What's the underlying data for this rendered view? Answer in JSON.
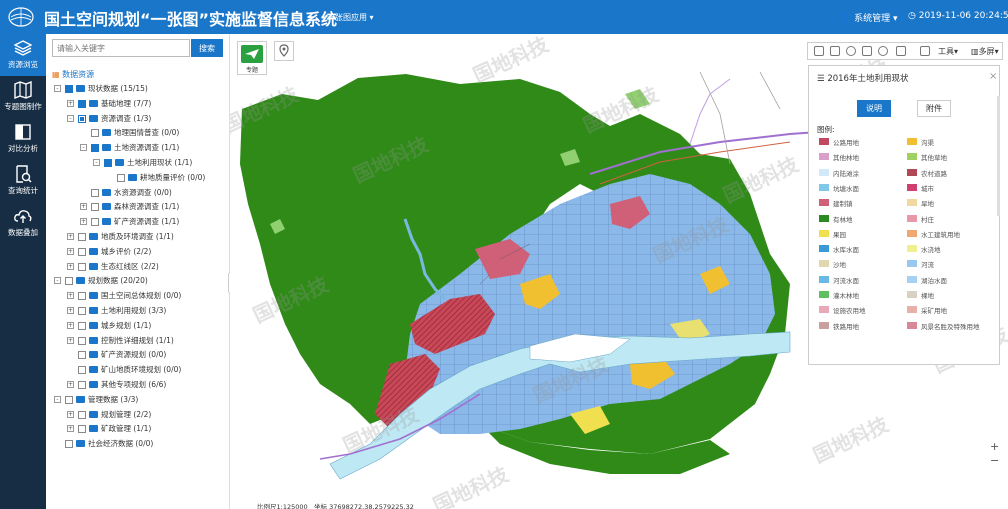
{
  "header": {
    "title": "国土空间规划“一张图”实施监督信息系统",
    "module": "一张图应用",
    "user": "系统管理",
    "datetime": "2019-11-06 20:24:51"
  },
  "nav": [
    {
      "label": "资源浏览",
      "active": true,
      "icon": "layers-icon"
    },
    {
      "label": "专题图制作",
      "icon": "map-icon"
    },
    {
      "label": "对比分析",
      "icon": "compare-icon"
    },
    {
      "label": "查询统计",
      "icon": "query-icon"
    },
    {
      "label": "数据叠加",
      "icon": "upload-cloud-icon"
    }
  ],
  "search": {
    "placeholder": "请输入关键字",
    "button": "搜索"
  },
  "tree_root": "数据资源",
  "tree": [
    {
      "label": "现状数据 (15/15)",
      "level": 0,
      "exp": "-",
      "chk": "on"
    },
    {
      "label": "基础地理 (7/7)",
      "level": 1,
      "exp": "+",
      "chk": "on"
    },
    {
      "label": "资源调查 (1/3)",
      "level": 1,
      "exp": "-",
      "chk": "half"
    },
    {
      "label": "地理国情普查 (0/0)",
      "level": 2,
      "exp": "",
      "chk": ""
    },
    {
      "label": "土地资源调查 (1/1)",
      "level": 2,
      "exp": "-",
      "chk": "on"
    },
    {
      "label": "土地利用现状 (1/1)",
      "level": 3,
      "exp": "-",
      "chk": "on"
    },
    {
      "label": "耕地质量评价 (0/0)",
      "level": 4,
      "exp": "",
      "chk": ""
    },
    {
      "label": "水资源调查 (0/0)",
      "level": 2,
      "exp": "",
      "chk": ""
    },
    {
      "label": "森林资源调查 (1/1)",
      "level": 2,
      "exp": "+",
      "chk": ""
    },
    {
      "label": "矿产资源调查 (1/1)",
      "level": 2,
      "exp": "+",
      "chk": ""
    },
    {
      "label": "地质及环境调查 (1/1)",
      "level": 1,
      "exp": "+",
      "chk": ""
    },
    {
      "label": "城乡评价 (2/2)",
      "level": 1,
      "exp": "+",
      "chk": ""
    },
    {
      "label": "生态红线区 (2/2)",
      "level": 1,
      "exp": "+",
      "chk": ""
    },
    {
      "label": "规划数据 (20/20)",
      "level": 0,
      "exp": "-",
      "chk": ""
    },
    {
      "label": "国土空间总体规划 (0/0)",
      "level": 1,
      "exp": "+",
      "chk": ""
    },
    {
      "label": "土地利用规划 (3/3)",
      "level": 1,
      "exp": "+",
      "chk": ""
    },
    {
      "label": "城乡规划 (1/1)",
      "level": 1,
      "exp": "+",
      "chk": ""
    },
    {
      "label": "控制性详细规划 (1/1)",
      "level": 1,
      "exp": "+",
      "chk": ""
    },
    {
      "label": "矿产资源规划 (0/0)",
      "level": 1,
      "exp": "",
      "chk": ""
    },
    {
      "label": "矿山地质环境规划 (0/0)",
      "level": 1,
      "exp": "",
      "chk": ""
    },
    {
      "label": "其他专项规划 (6/6)",
      "level": 1,
      "exp": "+",
      "chk": ""
    },
    {
      "label": "管理数据 (3/3)",
      "level": 0,
      "exp": "-",
      "chk": ""
    },
    {
      "label": "规划管理 (2/2)",
      "level": 1,
      "exp": "+",
      "chk": ""
    },
    {
      "label": "矿政管理 (1/1)",
      "level": 1,
      "exp": "+",
      "chk": ""
    },
    {
      "label": "社会经济数据 (0/0)",
      "level": 0,
      "exp": "",
      "chk": ""
    }
  ],
  "map": {
    "topic_button": "专题",
    "scale": "比例尺1:125000",
    "coords": "坐标 37698272.38,2579225.32",
    "toolbar": {
      "tools": "工具",
      "multiscreen": "多屏"
    }
  },
  "legend": {
    "title": "2016年土地利用现状",
    "tab_desc": "说明",
    "tab_attach": "附件",
    "label": "图例:",
    "items": [
      {
        "name": "公路用地",
        "color": "#c04860"
      },
      {
        "name": "沟渠",
        "color": "#f0c030"
      },
      {
        "name": "其他林地",
        "color": "#d8a0c8"
      },
      {
        "name": "其他草地",
        "color": "#a0d060"
      },
      {
        "name": "内陆滩涂",
        "color": "#d0e8f8"
      },
      {
        "name": "农村道路",
        "color": "#b04858"
      },
      {
        "name": "坑塘水面",
        "color": "#80c8e8"
      },
      {
        "name": "城市",
        "color": "#d04070"
      },
      {
        "name": "建制镇",
        "color": "#d06078"
      },
      {
        "name": "旱地",
        "color": "#f0d8a0"
      },
      {
        "name": "有林地",
        "color": "#2a8a20"
      },
      {
        "name": "村庄",
        "color": "#e898a8"
      },
      {
        "name": "果园",
        "color": "#f0e050"
      },
      {
        "name": "水工建筑用地",
        "color": "#f0a870"
      },
      {
        "name": "水库水面",
        "color": "#3a9ad8"
      },
      {
        "name": "水浇地",
        "color": "#f0f090"
      },
      {
        "name": "沙地",
        "color": "#e0d8b0"
      },
      {
        "name": "河流",
        "color": "#98c8f0"
      },
      {
        "name": "河流水面",
        "color": "#68b8e8"
      },
      {
        "name": "湖泊水面",
        "color": "#a8d0f0"
      },
      {
        "name": "灌木林地",
        "color": "#60c060"
      },
      {
        "name": "裸地",
        "color": "#d8d0c0"
      },
      {
        "name": "设施农用地",
        "color": "#e8a8b8"
      },
      {
        "name": "采矿用地",
        "color": "#e8b0a8"
      },
      {
        "name": "铁路用地",
        "color": "#c8a0a0"
      },
      {
        "name": "风景名胜及特殊用地",
        "color": "#d88898"
      }
    ]
  },
  "watermark": "国地科技"
}
